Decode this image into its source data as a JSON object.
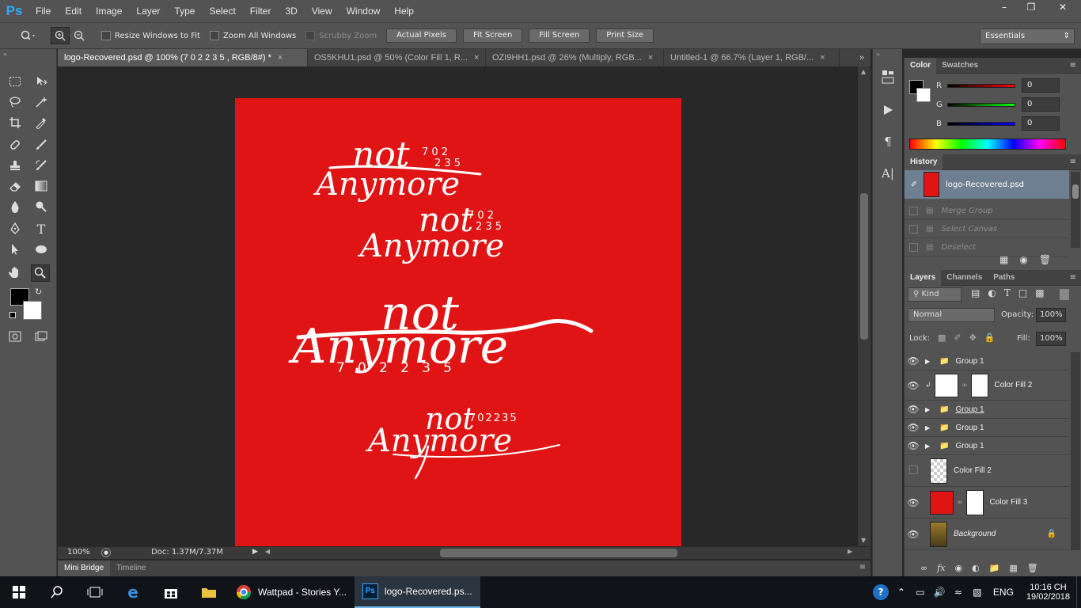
{
  "app": {
    "logo": "Ps"
  },
  "menu": [
    "File",
    "Edit",
    "Image",
    "Layer",
    "Type",
    "Select",
    "Filter",
    "3D",
    "View",
    "Window",
    "Help"
  ],
  "window_controls": [
    "–",
    "❐",
    "✕"
  ],
  "options": {
    "checks": [
      {
        "label": "Resize Windows to Fit",
        "enabled": true
      },
      {
        "label": "Zoom All Windows",
        "enabled": true
      },
      {
        "label": "Scrubby Zoom",
        "enabled": false
      }
    ],
    "buttons": [
      "Actual Pixels",
      "Fit Screen",
      "Fill Screen",
      "Print Size"
    ],
    "workspace": "Essentials"
  },
  "tabs": [
    {
      "label": "logo-Recovered.psd @ 100% (7 0 2      2 3 5 , RGB/8#) *",
      "active": true
    },
    {
      "label": "OS5KHU1.psd @ 50% (Color Fill 1, R...",
      "active": false
    },
    {
      "label": "OZI9HH1.psd @ 26% (Multiply, RGB...",
      "active": false
    },
    {
      "label": "Untitled-1 @ 66.7% (Layer 1, RGB/...",
      "active": false
    }
  ],
  "canvas": {
    "bg_color": "#e01414",
    "logo1": {
      "word1": "not",
      "word2": "Anymore",
      "nums1": "7 0 2",
      "nums2": "2 3 5"
    },
    "logo2": {
      "word1": "not",
      "word2": "Anymore",
      "nums1": "7 0 2",
      "nums2": "2 3 5"
    },
    "logo3": {
      "word1": "not",
      "word2": "Anymore",
      "nums": "7   0   2   2   3   5"
    },
    "logo4": {
      "word1": "not",
      "word2": "Anymore",
      "nums": "702235"
    }
  },
  "status": {
    "zoom": "100%",
    "doc": "Doc: 1.37M/7.37M"
  },
  "bottom_tabs": [
    "Mini Bridge",
    "Timeline"
  ],
  "color_panel": {
    "tabs": [
      "Color",
      "Swatches"
    ],
    "channels": [
      {
        "label": "R",
        "value": "0"
      },
      {
        "label": "G",
        "value": "0"
      },
      {
        "label": "B",
        "value": "0"
      }
    ]
  },
  "history": {
    "title": "History",
    "snapshot": "logo-Recovered.psd",
    "steps": [
      "Merge Group",
      "Select Canvas",
      "Deselect"
    ]
  },
  "layers_panel": {
    "tabs": [
      "Layers",
      "Channels",
      "Paths"
    ],
    "kind": "Kind",
    "blend": "Normal",
    "opacity_label": "Opacity:",
    "opacity": "100%",
    "lock_label": "Lock:",
    "fill_label": "Fill:",
    "fill": "100%",
    "layers": [
      {
        "name": "Group 1",
        "type": "group",
        "visible": true
      },
      {
        "name": "Color Fill 2",
        "type": "fill-white",
        "visible": true
      },
      {
        "name": "Group 1",
        "type": "group",
        "visible": true
      },
      {
        "name": "Group 1",
        "type": "group",
        "visible": true
      },
      {
        "name": "Group 1",
        "type": "group",
        "visible": true
      },
      {
        "name": "Color Fill 2",
        "type": "transparent",
        "visible": false
      },
      {
        "name": "Color Fill 3",
        "type": "fill-red",
        "visible": true
      },
      {
        "name": "Background",
        "type": "image",
        "visible": true
      }
    ]
  },
  "taskbar": {
    "apps": [
      {
        "label": "Wattpad - Stories Y...",
        "active": false
      },
      {
        "label": "logo-Recovered.ps...",
        "active": true
      }
    ],
    "lang": "ENG",
    "time": "10:16 CH",
    "date": "19/02/2018"
  }
}
